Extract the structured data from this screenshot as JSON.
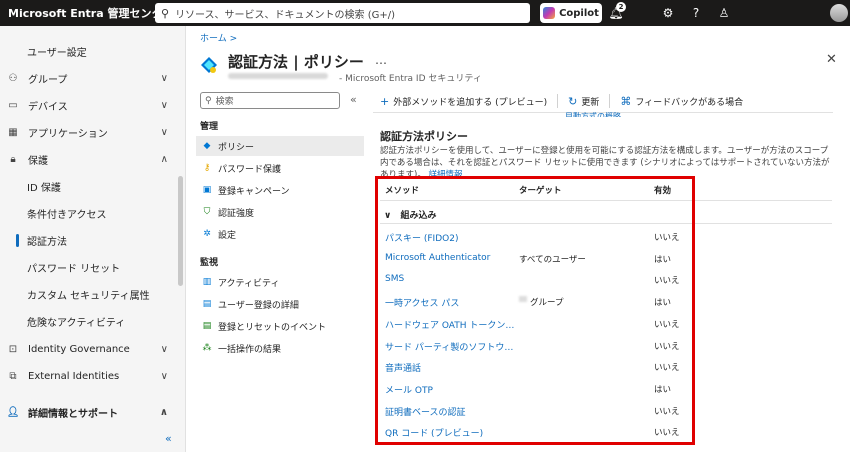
{
  "topbar": {
    "brand": "Microsoft Entra 管理センター",
    "search_placeholder": "リソース、サービス、ドキュメントの検索 (G+/)",
    "copilot_label": "Copilot",
    "notification_count": "2"
  },
  "leftnav": {
    "items": [
      {
        "label": "",
        "icon": "",
        "sub": true
      },
      {
        "label": "ユーザー設定",
        "sub": true
      },
      {
        "label": "グループ",
        "icon": "group-icon",
        "chevron": "chevron-down-icon"
      },
      {
        "label": "デバイス",
        "icon": "devices-icon",
        "chevron": "chevron-down-icon"
      },
      {
        "label": "アプリケーション",
        "icon": "apps-icon",
        "chevron": "chevron-down-icon"
      },
      {
        "label": "保護",
        "icon": "lock-icon",
        "chevron": "chevron-up-icon"
      },
      {
        "label": "ID 保護",
        "sub": true
      },
      {
        "label": "条件付きアクセス",
        "sub": true
      },
      {
        "label": "認証方法",
        "sub": true,
        "active": true
      },
      {
        "label": "パスワード リセット",
        "sub": true
      },
      {
        "label": "カスタム セキュリティ属性",
        "sub": true
      },
      {
        "label": "危険なアクティビティ",
        "sub": true
      },
      {
        "label": "Identity Governance",
        "icon": "governance-icon",
        "chevron": "chevron-down-icon"
      },
      {
        "label": "External Identities",
        "icon": "external-icon",
        "chevron": "chevron-down-icon"
      },
      {
        "label": "詳細情報とサポート",
        "icon": "support-icon",
        "chevron": "chevron-up-icon",
        "bold": true
      }
    ],
    "collapse_glyph": "«"
  },
  "breadcrumb": "ホーム >",
  "page": {
    "title": "認証方法 | ポリシー",
    "more": "…",
    "subtitle": "- Microsoft Entra ID セキュリティ",
    "close": "✕"
  },
  "menu": {
    "search_placeholder": "検索",
    "collapse": "«",
    "section1": "管理",
    "section2": "監視",
    "items1": [
      "ポリシー",
      "パスワード保護",
      "登録キャンペーン",
      "認証強度",
      "設定"
    ],
    "items2": [
      "アクティビティ",
      "ユーザー登録の詳細",
      "登録とリセットのイベント",
      "一括操作の結果"
    ]
  },
  "commands": {
    "add": "外部メソッドを追加する (プレビュー)",
    "refresh": "更新",
    "feedback": "フィードバックがある場合"
  },
  "cut_link": "目動方式の概略",
  "policy": {
    "title": "認証方法ポリシー",
    "description": "認証方法ポリシーを使用して、ユーザーに登録と使用を可能にする認証方法を構成します。ユーザーが方法のスコープ内である場合は、それを認証とパスワード リセットに使用できます (シナリオによってはサポートされていない方法があります)。",
    "learn_more": "詳細情報"
  },
  "table": {
    "headers": [
      "メソッド",
      "ターゲット",
      "有効"
    ],
    "group": "組み込み",
    "rows": [
      {
        "name": "パスキー (FIDO2)",
        "target": "",
        "enabled": "いいえ"
      },
      {
        "name": "Microsoft Authenticator",
        "target": "すべてのユーザー",
        "enabled": "はい"
      },
      {
        "name": "SMS",
        "target": "",
        "enabled": "いいえ"
      },
      {
        "name": "一時アクセス パス",
        "target": "グループ",
        "enabled": "はい"
      },
      {
        "name": "ハードウェア OATH トークン (プレビュー)",
        "target": "",
        "enabled": "いいえ"
      },
      {
        "name": "サード パーティ製のソフトウェア OATH トークン",
        "target": "",
        "enabled": "いいえ"
      },
      {
        "name": "音声通話",
        "target": "",
        "enabled": "いいえ"
      },
      {
        "name": "メール OTP",
        "target": "",
        "enabled": "はい"
      },
      {
        "name": "証明書ベースの認証",
        "target": "",
        "enabled": "いいえ"
      },
      {
        "name": "QR コード (プレビュー)",
        "target": "",
        "enabled": "いいえ"
      }
    ]
  },
  "colors": {
    "accent": "#0f6cbd",
    "highlight": "#e00000",
    "topbar": "#1b1a19"
  }
}
